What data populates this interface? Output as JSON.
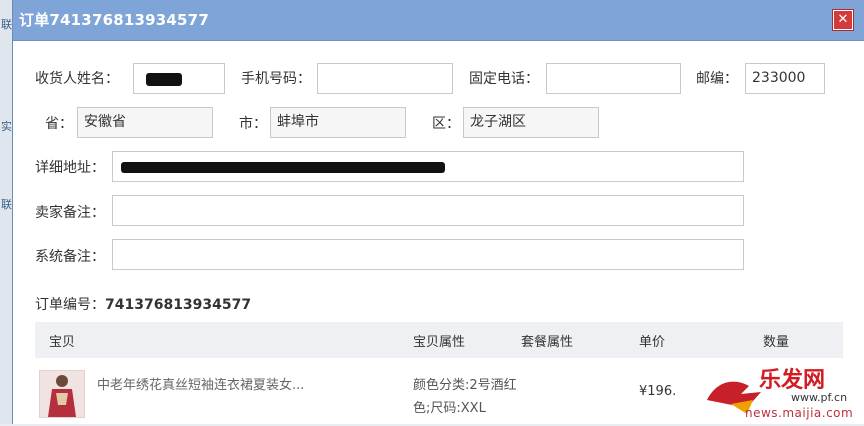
{
  "dialog": {
    "title": "订单741376813934577"
  },
  "form": {
    "receiver_label": "收货人姓名：",
    "mobile_label": "手机号码：",
    "phone_label": "固定电话：",
    "zip_label": "邮编：",
    "zip_value": "233000",
    "province_label": "省：",
    "province_value": "安徽省",
    "city_label": "市：",
    "city_value": "蚌埠市",
    "district_label": "区：",
    "district_value": "龙子湖区",
    "address_label": "详细地址：",
    "seller_note_label": "卖家备注：",
    "system_note_label": "系统备注："
  },
  "order": {
    "label": "订单编号：",
    "number": "741376813934577"
  },
  "table": {
    "headers": [
      "宝贝",
      "宝贝属性",
      "套餐属性",
      "单价",
      "数量"
    ],
    "rows": [
      {
        "name": "中老年绣花真丝短袖连衣裙夏装女...",
        "attr_line1": "颜色分类:2号酒红",
        "attr_line2": "色;尺码:XXL",
        "price": "¥196."
      }
    ]
  },
  "watermark": {
    "brand": "乐发网",
    "url": "news.maijia.com",
    "site": "www.pf.cn"
  },
  "colors": {
    "titlebar": "#7fa4d8",
    "close": "#d23b3b",
    "header_bg": "#eef0f3"
  }
}
